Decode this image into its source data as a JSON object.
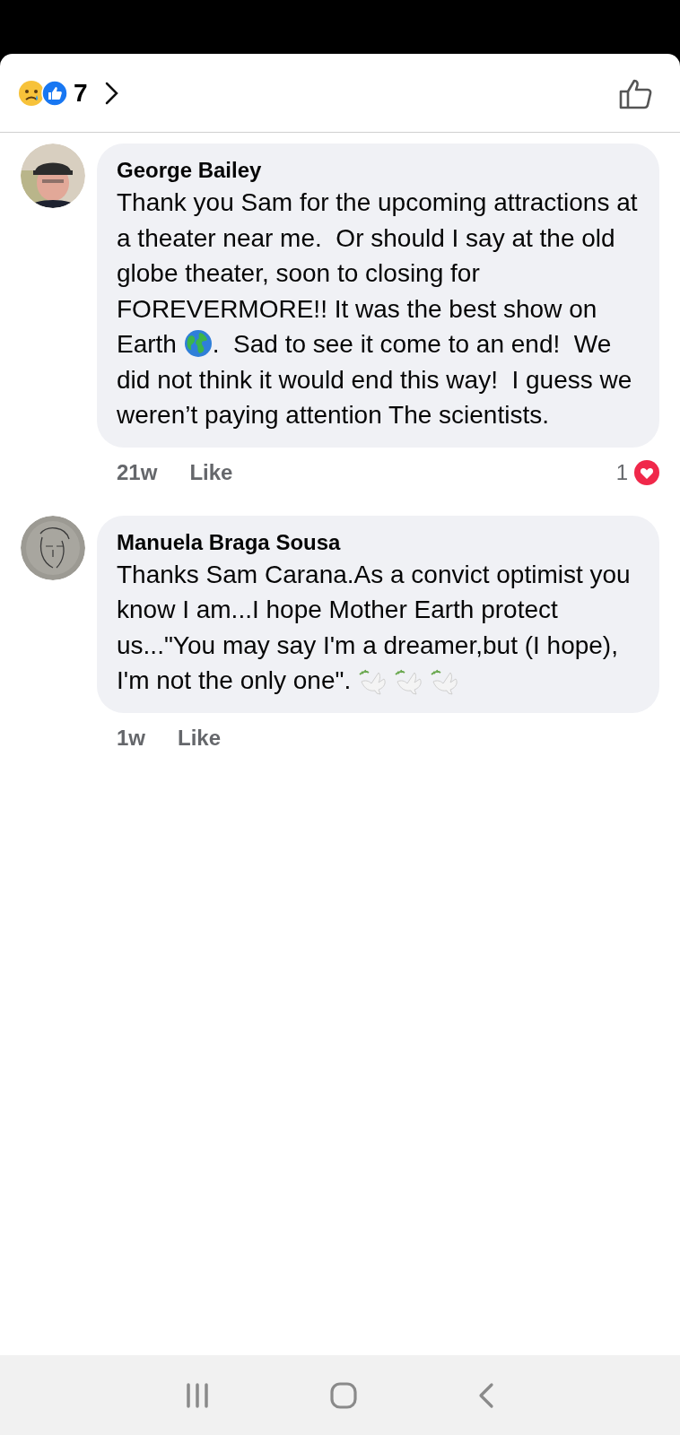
{
  "reactions_header": {
    "count": "7"
  },
  "comments": [
    {
      "author": "George Bailey",
      "parts": [
        {
          "kind": "text",
          "text": "Thank you Sam for the upcoming attractions at a theater near me.  Or should I say at the old globe theater, soon to closing for FOREVERMORE!! It was the best show on Earth "
        },
        {
          "kind": "globe"
        },
        {
          "kind": "text",
          "text": ".  Sad to see it come to an end!  We did not think it would end this way!  I guess we weren’t paying attention The scientists."
        }
      ],
      "time": "21w",
      "like": "Like",
      "reaction_count": "1"
    },
    {
      "author": "Manuela Braga Sousa",
      "parts": [
        {
          "kind": "text",
          "text": "Thanks Sam Carana.As a convict optimist you know I am...I hope Mother Earth protect us...\"You may say I'm a dreamer,but (I hope), I'm not the only one\". "
        },
        {
          "kind": "dove"
        },
        {
          "kind": "dove"
        },
        {
          "kind": "dove"
        }
      ],
      "time": "1w",
      "like": "Like"
    }
  ]
}
